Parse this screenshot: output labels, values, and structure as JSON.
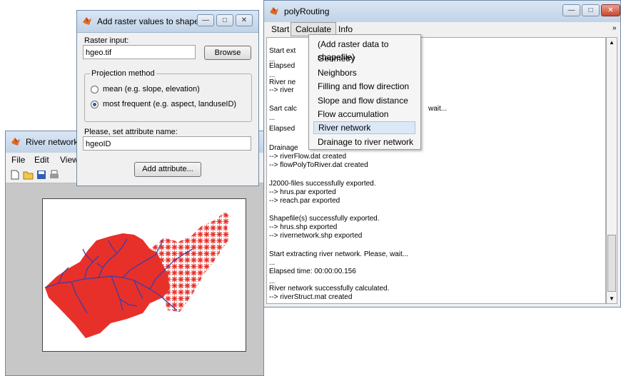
{
  "poly": {
    "title": "polyRouting",
    "menu": [
      "Start",
      "Calculate",
      "Info"
    ],
    "log": [
      "Start ext",
      "...",
      "Elapsed",
      "...",
      "River ne",
      "--> river",
      "",
      "Sart calc",
      "...",
      "Elapsed",
      "",
      "Drainage",
      "--> riverFlow.dat created",
      "--> flowPolyToRiver.dat created",
      "",
      "J2000-files successfully exported.",
      "--> hrus.par exported",
      "--> reach.par exported",
      "",
      "Shapefile(s) successfully exported.",
      "--> hrus.shp exported",
      "--> rivernetwork.shp exported",
      "",
      "Start extracting river network. Please, wait...",
      "...",
      "Elapsed time: 00:00:00.156",
      "...",
      "River network successfully calculated.",
      "--> riverStruct.mat created"
    ],
    "wait_fragment": "wait..."
  },
  "calc_menu": {
    "items": [
      "(Add raster data to shapefile)",
      "Geometry",
      "Neighbors",
      "Filling and flow direction",
      "Slope and flow distance",
      "Flow accumulation",
      "River network",
      "Drainage to river network"
    ],
    "highlighted": "River network"
  },
  "raster": {
    "title": "Add raster values to shapefile",
    "raster_input_label": "Raster input:",
    "raster_input_value": "hgeo.tif",
    "browse": "Browse",
    "projection_group": "Projection method",
    "option_mean": "mean (e.g. slope, elevation)",
    "option_frequent": "most frequent (e.g. aspect, landuseID)",
    "selected_option": "most frequent (e.g. aspect, landuseID)",
    "attr_label": "Please, set attribute name:",
    "attr_value": "hgeoID",
    "add_button": "Add attribute..."
  },
  "river": {
    "title": "River network",
    "menu": [
      "File",
      "Edit",
      "View"
    ]
  },
  "colors": {
    "polygons": "#e8302a",
    "rivers": "#3a3ea8",
    "highlight": "#dce8f6"
  }
}
